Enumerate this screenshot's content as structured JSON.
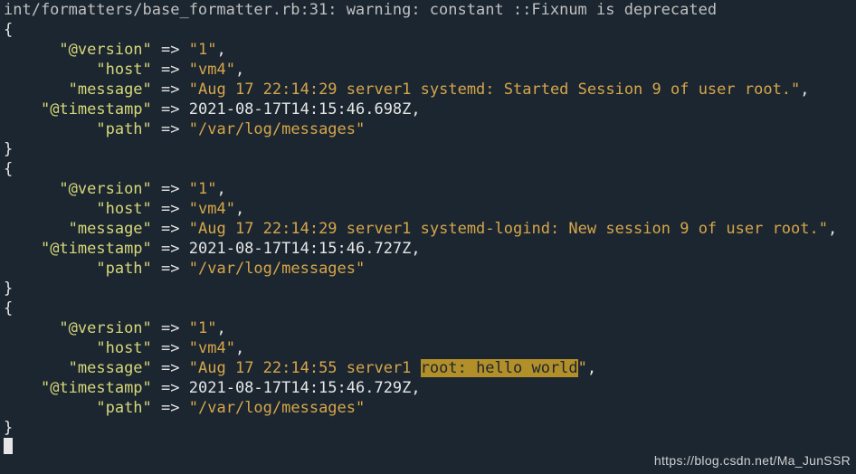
{
  "topline": "int/formatters/base_formatter.rb:31: warning: constant ::Fixnum is deprecated",
  "records": [
    {
      "version": "1",
      "host": "vm4",
      "message": "Aug 17 22:14:29 server1 systemd: Started Session 9 of user root.",
      "timestamp": "2021-08-17T14:15:46.698Z",
      "path": "/var/log/messages"
    },
    {
      "version": "1",
      "host": "vm4",
      "message": "Aug 17 22:14:29 server1 systemd-logind: New session 9 of user root.",
      "timestamp": "2021-08-17T14:15:46.727Z",
      "path": "/var/log/messages"
    },
    {
      "version": "1",
      "host": "vm4",
      "message_prefix": "Aug 17 22:14:55 server1 ",
      "message_highlight": "root: hello world",
      "timestamp": "2021-08-17T14:15:46.729Z",
      "path": "/var/log/messages"
    }
  ],
  "watermark": "https://blog.csdn.net/Ma_JunSSR"
}
